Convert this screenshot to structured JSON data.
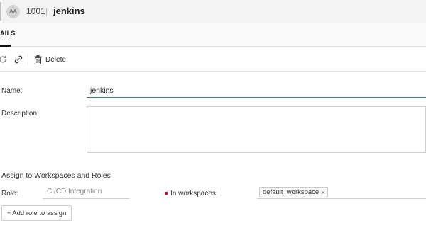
{
  "header": {
    "avatar_initials": "AA",
    "entity_id": "1001",
    "id_separator": "|",
    "entity_name": "jenkins"
  },
  "tabs": {
    "active_label": "AILS"
  },
  "toolbar": {
    "delete_label": "Delete",
    "icons": [
      "refresh-icon",
      "link-icon",
      "trash-icon"
    ]
  },
  "form": {
    "name_label": "Name:",
    "name_value": "jenkins",
    "description_label": "Description:",
    "description_value": ""
  },
  "assignment": {
    "section_title": "Assign to Workspaces and Roles",
    "role_label": "Role:",
    "role_value": "CI/CD Integration",
    "workspaces_label": "In workspaces:",
    "workspace_chip": "default_workspace",
    "chip_remove": "×",
    "add_role_label": "+ Add role to assign"
  },
  "colors": {
    "accent": "#2f7dc0",
    "required": "#c8102e"
  }
}
